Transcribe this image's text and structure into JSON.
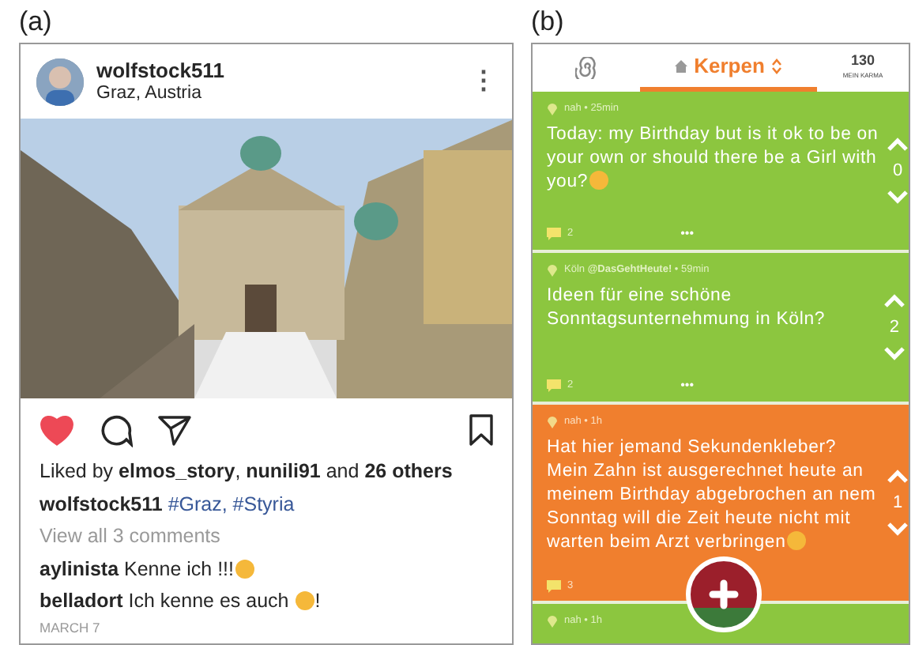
{
  "figure_labels": [
    "(a)",
    "(b)"
  ],
  "instagram_post": {
    "username": "wolfstock511",
    "location": "Graz, Austria",
    "more": "⋮",
    "liked": true,
    "likes": "Liked by **elmos_story**, **nunili91** and **26 others**",
    "caption": {
      "user": "wolfstock511",
      "hashtags": "#Graz, #Styria"
    },
    "view_comments": "View all 3 comments",
    "comments": [
      {
        "user": "aylinista",
        "text": "Kenne ich !!!",
        "emoji": true
      },
      {
        "user": "belladort",
        "text": "Ich kenne es auch ",
        "emoji": true,
        "after": "!"
      }
    ],
    "date": "MARCH 7"
  },
  "jodel": {
    "location": "Kerpen",
    "karma": "130",
    "karma_label": "MEIN KARMA",
    "posts": [
      {
        "color": "#8cc63f",
        "meta": "nah • 25min",
        "text": "Today: my Birthday but is it ok to be on your own or should there be a Girl with you?",
        "emoji": true,
        "votes": "0",
        "comments": "2",
        "more": "•••"
      },
      {
        "color": "#8cc63f",
        "meta": "Köln **@DasGehtHeute!** • 59min",
        "text": "Ideen für eine schöne Sonntagsunternehmung in Köln?",
        "emoji": false,
        "votes": "2",
        "comments": "2",
        "more": "•••"
      },
      {
        "color": "#f07f2e",
        "meta": "nah • 1h",
        "text": "Hat hier jemand Sekundenkleber? Mein Zahn ist ausgerechnet heute an meinem Birthday abgebrochen an nem Sonntag will die Zeit heute nicht mit warten beim Arzt verbringen",
        "emoji": true,
        "votes": "1",
        "comments": "3"
      },
      {
        "color": "#8cc63f",
        "meta": "nah • 1h"
      }
    ]
  }
}
